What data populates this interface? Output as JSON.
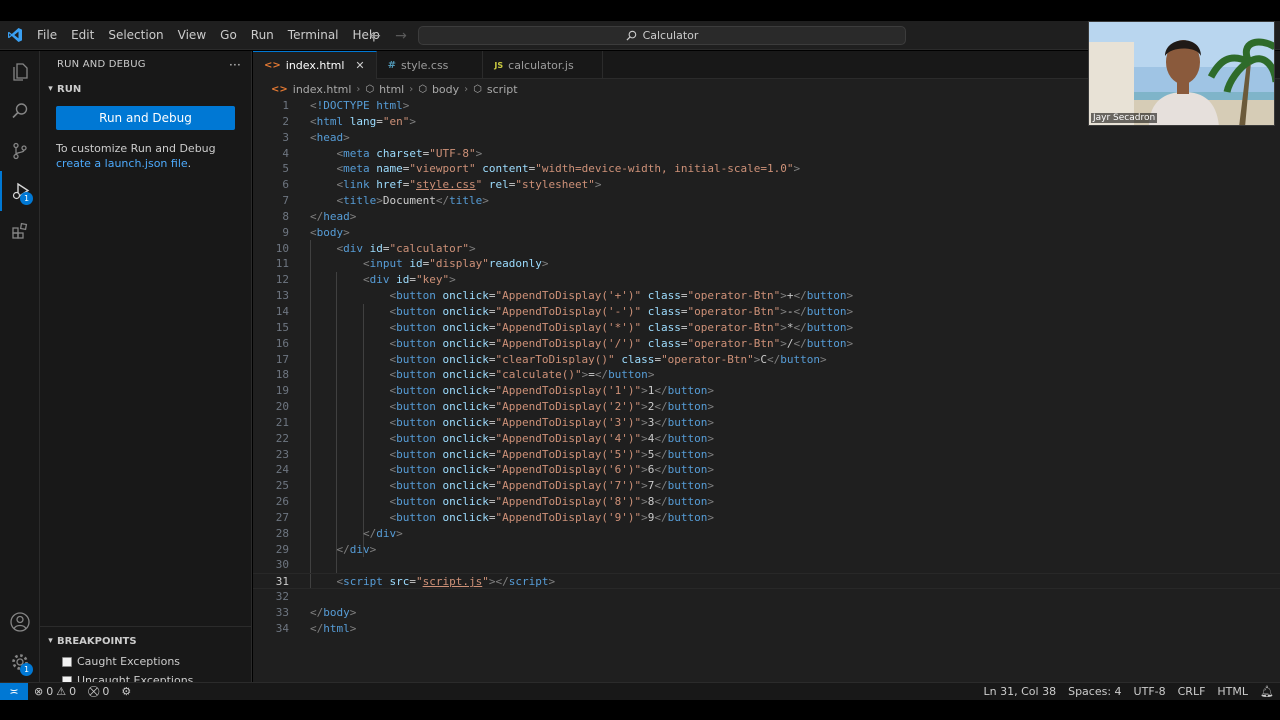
{
  "menu": [
    "File",
    "Edit",
    "Selection",
    "View",
    "Go",
    "Run",
    "Terminal",
    "Help"
  ],
  "command_center": "Calculator",
  "sidebar": {
    "title": "RUN AND DEBUG",
    "more": "···",
    "section_run": "RUN",
    "run_button": "Run and Debug",
    "hint_text": "To customize Run and Debug ",
    "hint_link": "create a launch.json file",
    "hint_end": ".",
    "section_breakpoints": "BREAKPOINTS",
    "breakpoints": [
      "Caught Exceptions",
      "Uncaught Exceptions"
    ]
  },
  "activity_badges": {
    "run_debug": "1",
    "settings": "1"
  },
  "tabs": [
    {
      "label": "index.html",
      "icon": "html-file-icon",
      "active": true
    },
    {
      "label": "style.css",
      "icon": "css-file-icon",
      "active": false
    },
    {
      "label": "calculator.js",
      "icon": "js-file-icon",
      "active": false
    }
  ],
  "breadcrumb": [
    "index.html",
    "html",
    "body",
    "script"
  ],
  "code_lines": [
    [
      [
        "pt",
        "<"
      ],
      [
        "tg",
        "!DOCTYPE"
      ],
      [
        "tx",
        " "
      ],
      [
        "tg",
        "html"
      ],
      [
        "pt",
        ">"
      ]
    ],
    [
      [
        "pt",
        "<"
      ],
      [
        "tg",
        "html"
      ],
      [
        "tx",
        " "
      ],
      [
        "at",
        "lang"
      ],
      [
        "tx",
        "="
      ],
      [
        "st",
        "\"en\""
      ],
      [
        "pt",
        ">"
      ]
    ],
    [
      [
        "pt",
        "<"
      ],
      [
        "tg",
        "head"
      ],
      [
        "pt",
        ">"
      ]
    ],
    [
      [
        "tx",
        "    "
      ],
      [
        "pt",
        "<"
      ],
      [
        "tg",
        "meta"
      ],
      [
        "tx",
        " "
      ],
      [
        "at",
        "charset"
      ],
      [
        "tx",
        "="
      ],
      [
        "st",
        "\"UTF-8\""
      ],
      [
        "pt",
        ">"
      ]
    ],
    [
      [
        "tx",
        "    "
      ],
      [
        "pt",
        "<"
      ],
      [
        "tg",
        "meta"
      ],
      [
        "tx",
        " "
      ],
      [
        "at",
        "name"
      ],
      [
        "tx",
        "="
      ],
      [
        "st",
        "\"viewport\""
      ],
      [
        "tx",
        " "
      ],
      [
        "at",
        "content"
      ],
      [
        "tx",
        "="
      ],
      [
        "st",
        "\"width=device-width, initial-scale=1.0\""
      ],
      [
        "pt",
        ">"
      ]
    ],
    [
      [
        "tx",
        "    "
      ],
      [
        "pt",
        "<"
      ],
      [
        "tg",
        "link"
      ],
      [
        "tx",
        " "
      ],
      [
        "at",
        "href"
      ],
      [
        "tx",
        "="
      ],
      [
        "st",
        "\""
      ],
      [
        "ul",
        "style.css"
      ],
      [
        "st",
        "\""
      ],
      [
        "tx",
        " "
      ],
      [
        "at",
        "rel"
      ],
      [
        "tx",
        "="
      ],
      [
        "st",
        "\"stylesheet\""
      ],
      [
        "pt",
        ">"
      ]
    ],
    [
      [
        "tx",
        "    "
      ],
      [
        "pt",
        "<"
      ],
      [
        "tg",
        "title"
      ],
      [
        "pt",
        ">"
      ],
      [
        "tx",
        "Document"
      ],
      [
        "pt",
        "</"
      ],
      [
        "tg",
        "title"
      ],
      [
        "pt",
        ">"
      ]
    ],
    [
      [
        "pt",
        "</"
      ],
      [
        "tg",
        "head"
      ],
      [
        "pt",
        ">"
      ]
    ],
    [
      [
        "pt",
        "<"
      ],
      [
        "tg",
        "body"
      ],
      [
        "pt",
        ">"
      ]
    ],
    [
      [
        "tx",
        "    "
      ],
      [
        "pt",
        "<"
      ],
      [
        "tg",
        "div"
      ],
      [
        "tx",
        " "
      ],
      [
        "at",
        "id"
      ],
      [
        "tx",
        "="
      ],
      [
        "st",
        "\"calculator\""
      ],
      [
        "pt",
        ">"
      ]
    ],
    [
      [
        "tx",
        "        "
      ],
      [
        "pt",
        "<"
      ],
      [
        "tg",
        "input"
      ],
      [
        "tx",
        " "
      ],
      [
        "at",
        "id"
      ],
      [
        "tx",
        "="
      ],
      [
        "st",
        "\"display\""
      ],
      [
        "at",
        "readonly"
      ],
      [
        "pt",
        ">"
      ]
    ],
    [
      [
        "tx",
        "        "
      ],
      [
        "pt",
        "<"
      ],
      [
        "tg",
        "div"
      ],
      [
        "tx",
        " "
      ],
      [
        "at",
        "id"
      ],
      [
        "tx",
        "="
      ],
      [
        "st",
        "\"key\""
      ],
      [
        "pt",
        ">"
      ]
    ],
    [
      [
        "tx",
        "            "
      ],
      [
        "pt",
        "<"
      ],
      [
        "tg",
        "button"
      ],
      [
        "tx",
        " "
      ],
      [
        "at",
        "onclick"
      ],
      [
        "tx",
        "="
      ],
      [
        "st",
        "\"AppendToDisplay('+')\""
      ],
      [
        "tx",
        " "
      ],
      [
        "at",
        "class"
      ],
      [
        "tx",
        "="
      ],
      [
        "st",
        "\"operator-Btn\""
      ],
      [
        "pt",
        ">"
      ],
      [
        "tx",
        "+"
      ],
      [
        "pt",
        "</"
      ],
      [
        "tg",
        "button"
      ],
      [
        "pt",
        ">"
      ]
    ],
    [
      [
        "tx",
        "            "
      ],
      [
        "pt",
        "<"
      ],
      [
        "tg",
        "button"
      ],
      [
        "tx",
        " "
      ],
      [
        "at",
        "onclick"
      ],
      [
        "tx",
        "="
      ],
      [
        "st",
        "\"AppendToDisplay('-')\""
      ],
      [
        "tx",
        " "
      ],
      [
        "at",
        "class"
      ],
      [
        "tx",
        "="
      ],
      [
        "st",
        "\"operator-Btn\""
      ],
      [
        "pt",
        ">"
      ],
      [
        "tx",
        "-"
      ],
      [
        "pt",
        "</"
      ],
      [
        "tg",
        "button"
      ],
      [
        "pt",
        ">"
      ]
    ],
    [
      [
        "tx",
        "            "
      ],
      [
        "pt",
        "<"
      ],
      [
        "tg",
        "button"
      ],
      [
        "tx",
        " "
      ],
      [
        "at",
        "onclick"
      ],
      [
        "tx",
        "="
      ],
      [
        "st",
        "\"AppendToDisplay('*')\""
      ],
      [
        "tx",
        " "
      ],
      [
        "at",
        "class"
      ],
      [
        "tx",
        "="
      ],
      [
        "st",
        "\"operator-Btn\""
      ],
      [
        "pt",
        ">"
      ],
      [
        "tx",
        "*"
      ],
      [
        "pt",
        "</"
      ],
      [
        "tg",
        "button"
      ],
      [
        "pt",
        ">"
      ]
    ],
    [
      [
        "tx",
        "            "
      ],
      [
        "pt",
        "<"
      ],
      [
        "tg",
        "button"
      ],
      [
        "tx",
        " "
      ],
      [
        "at",
        "onclick"
      ],
      [
        "tx",
        "="
      ],
      [
        "st",
        "\"AppendToDisplay('/')\""
      ],
      [
        "tx",
        " "
      ],
      [
        "at",
        "class"
      ],
      [
        "tx",
        "="
      ],
      [
        "st",
        "\"operator-Btn\""
      ],
      [
        "pt",
        ">"
      ],
      [
        "tx",
        "/"
      ],
      [
        "pt",
        "</"
      ],
      [
        "tg",
        "button"
      ],
      [
        "pt",
        ">"
      ]
    ],
    [
      [
        "tx",
        "            "
      ],
      [
        "pt",
        "<"
      ],
      [
        "tg",
        "button"
      ],
      [
        "tx",
        " "
      ],
      [
        "at",
        "onclick"
      ],
      [
        "tx",
        "="
      ],
      [
        "st",
        "\"clearToDisplay()\""
      ],
      [
        "tx",
        " "
      ],
      [
        "at",
        "class"
      ],
      [
        "tx",
        "="
      ],
      [
        "st",
        "\"operator-Btn\""
      ],
      [
        "pt",
        ">"
      ],
      [
        "tx",
        "C"
      ],
      [
        "pt",
        "</"
      ],
      [
        "tg",
        "button"
      ],
      [
        "pt",
        ">"
      ]
    ],
    [
      [
        "tx",
        "            "
      ],
      [
        "pt",
        "<"
      ],
      [
        "tg",
        "button"
      ],
      [
        "tx",
        " "
      ],
      [
        "at",
        "onclick"
      ],
      [
        "tx",
        "="
      ],
      [
        "st",
        "\"calculate()\""
      ],
      [
        "pt",
        ">"
      ],
      [
        "tx",
        "="
      ],
      [
        "pt",
        "</"
      ],
      [
        "tg",
        "button"
      ],
      [
        "pt",
        ">"
      ]
    ],
    [
      [
        "tx",
        "            "
      ],
      [
        "pt",
        "<"
      ],
      [
        "tg",
        "button"
      ],
      [
        "tx",
        " "
      ],
      [
        "at",
        "onclick"
      ],
      [
        "tx",
        "="
      ],
      [
        "st",
        "\"AppendToDisplay('1')\""
      ],
      [
        "pt",
        ">"
      ],
      [
        "tx",
        "1"
      ],
      [
        "pt",
        "</"
      ],
      [
        "tg",
        "button"
      ],
      [
        "pt",
        ">"
      ]
    ],
    [
      [
        "tx",
        "            "
      ],
      [
        "pt",
        "<"
      ],
      [
        "tg",
        "button"
      ],
      [
        "tx",
        " "
      ],
      [
        "at",
        "onclick"
      ],
      [
        "tx",
        "="
      ],
      [
        "st",
        "\"AppendToDisplay('2')\""
      ],
      [
        "pt",
        ">"
      ],
      [
        "tx",
        "2"
      ],
      [
        "pt",
        "</"
      ],
      [
        "tg",
        "button"
      ],
      [
        "pt",
        ">"
      ]
    ],
    [
      [
        "tx",
        "            "
      ],
      [
        "pt",
        "<"
      ],
      [
        "tg",
        "button"
      ],
      [
        "tx",
        " "
      ],
      [
        "at",
        "onclick"
      ],
      [
        "tx",
        "="
      ],
      [
        "st",
        "\"AppendToDisplay('3')\""
      ],
      [
        "pt",
        ">"
      ],
      [
        "tx",
        "3"
      ],
      [
        "pt",
        "</"
      ],
      [
        "tg",
        "button"
      ],
      [
        "pt",
        ">"
      ]
    ],
    [
      [
        "tx",
        "            "
      ],
      [
        "pt",
        "<"
      ],
      [
        "tg",
        "button"
      ],
      [
        "tx",
        " "
      ],
      [
        "at",
        "onclick"
      ],
      [
        "tx",
        "="
      ],
      [
        "st",
        "\"AppendToDisplay('4')\""
      ],
      [
        "pt",
        ">"
      ],
      [
        "tx",
        "4"
      ],
      [
        "pt",
        "</"
      ],
      [
        "tg",
        "button"
      ],
      [
        "pt",
        ">"
      ]
    ],
    [
      [
        "tx",
        "            "
      ],
      [
        "pt",
        "<"
      ],
      [
        "tg",
        "button"
      ],
      [
        "tx",
        " "
      ],
      [
        "at",
        "onclick"
      ],
      [
        "tx",
        "="
      ],
      [
        "st",
        "\"AppendToDisplay('5')\""
      ],
      [
        "pt",
        ">"
      ],
      [
        "tx",
        "5"
      ],
      [
        "pt",
        "</"
      ],
      [
        "tg",
        "button"
      ],
      [
        "pt",
        ">"
      ]
    ],
    [
      [
        "tx",
        "            "
      ],
      [
        "pt",
        "<"
      ],
      [
        "tg",
        "button"
      ],
      [
        "tx",
        " "
      ],
      [
        "at",
        "onclick"
      ],
      [
        "tx",
        "="
      ],
      [
        "st",
        "\"AppendToDisplay('6')\""
      ],
      [
        "pt",
        ">"
      ],
      [
        "tx",
        "6"
      ],
      [
        "pt",
        "</"
      ],
      [
        "tg",
        "button"
      ],
      [
        "pt",
        ">"
      ]
    ],
    [
      [
        "tx",
        "            "
      ],
      [
        "pt",
        "<"
      ],
      [
        "tg",
        "button"
      ],
      [
        "tx",
        " "
      ],
      [
        "at",
        "onclick"
      ],
      [
        "tx",
        "="
      ],
      [
        "st",
        "\"AppendToDisplay('7')\""
      ],
      [
        "pt",
        ">"
      ],
      [
        "tx",
        "7"
      ],
      [
        "pt",
        "</"
      ],
      [
        "tg",
        "button"
      ],
      [
        "pt",
        ">"
      ]
    ],
    [
      [
        "tx",
        "            "
      ],
      [
        "pt",
        "<"
      ],
      [
        "tg",
        "button"
      ],
      [
        "tx",
        " "
      ],
      [
        "at",
        "onclick"
      ],
      [
        "tx",
        "="
      ],
      [
        "st",
        "\"AppendToDisplay('8')\""
      ],
      [
        "pt",
        ">"
      ],
      [
        "tx",
        "8"
      ],
      [
        "pt",
        "</"
      ],
      [
        "tg",
        "button"
      ],
      [
        "pt",
        ">"
      ]
    ],
    [
      [
        "tx",
        "            "
      ],
      [
        "pt",
        "<"
      ],
      [
        "tg",
        "button"
      ],
      [
        "tx",
        " "
      ],
      [
        "at",
        "onclick"
      ],
      [
        "tx",
        "="
      ],
      [
        "st",
        "\"AppendToDisplay('9')\""
      ],
      [
        "pt",
        ">"
      ],
      [
        "tx",
        "9"
      ],
      [
        "pt",
        "</"
      ],
      [
        "tg",
        "button"
      ],
      [
        "pt",
        ">"
      ]
    ],
    [
      [
        "tx",
        "        "
      ],
      [
        "pt",
        "</"
      ],
      [
        "tg",
        "div"
      ],
      [
        "pt",
        ">"
      ]
    ],
    [
      [
        "tx",
        "    "
      ],
      [
        "pt",
        "</"
      ],
      [
        "tg",
        "div"
      ],
      [
        "pt",
        ">"
      ]
    ],
    [],
    [
      [
        "tx",
        "    "
      ],
      [
        "pt",
        "<"
      ],
      [
        "tg",
        "script"
      ],
      [
        "tx",
        " "
      ],
      [
        "at",
        "src"
      ],
      [
        "tx",
        "="
      ],
      [
        "st",
        "\""
      ],
      [
        "ul",
        "script.js"
      ],
      [
        "st",
        "\""
      ],
      [
        "pt",
        "></"
      ],
      [
        "tg",
        "script"
      ],
      [
        "pt",
        ">"
      ]
    ],
    [],
    [
      [
        "pt",
        "</"
      ],
      [
        "tg",
        "body"
      ],
      [
        "pt",
        ">"
      ]
    ],
    [
      [
        "pt",
        "</"
      ],
      [
        "tg",
        "html"
      ],
      [
        "pt",
        ">"
      ]
    ]
  ],
  "current_line": 31,
  "webcam": {
    "name": "Jayr Secadron"
  },
  "status": {
    "errors": "0",
    "warnings": "0",
    "ports": "0",
    "position": "Ln 31, Col 38",
    "spaces": "Spaces: 4",
    "encoding": "UTF-8",
    "eol": "CRLF",
    "language": "HTML"
  },
  "colors": {
    "accent": "#0078d4",
    "tag": "#569cd6",
    "attribute": "#9cdcfe",
    "string": "#ce9178"
  }
}
